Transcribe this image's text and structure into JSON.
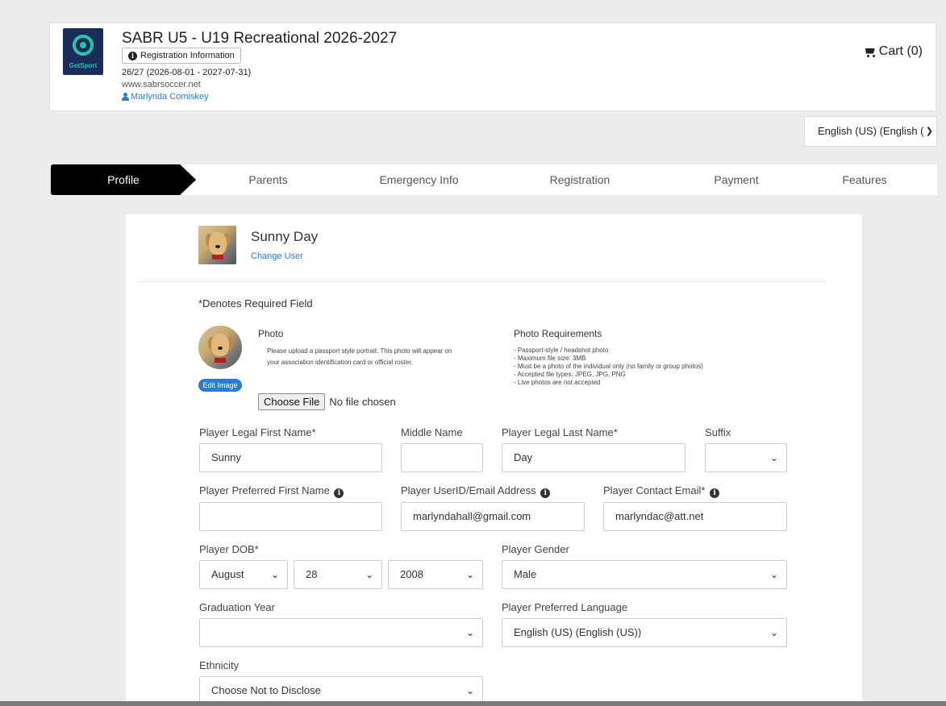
{
  "header": {
    "logo_text": "GotSport",
    "title": "SABR U5 - U19 Recreational 2026-2027",
    "registration_info_label": "Registration Information",
    "season": "26/27 (2026-08-01 - 2027-07-31)",
    "website": "www.sabrsoccer.net",
    "user": "Marlynda Comiskey",
    "cart_label": "Cart (0)"
  },
  "language_select": {
    "value": "English (US) (English ("
  },
  "steps": [
    {
      "label": "Profile",
      "active": true
    },
    {
      "label": "Parents"
    },
    {
      "label": "Emergency Info"
    },
    {
      "label": "Registration"
    },
    {
      "label": "Payment"
    },
    {
      "label": "Features"
    }
  ],
  "profile": {
    "name": "Sunny Day",
    "change_user_label": "Change User",
    "required_note": "*Denotes Required Field",
    "photo_label": "Photo",
    "photo_help": "Please upload a passport style portrait. This photo will appear on your association identification card or official roster.",
    "edit_image_label": "Edit Image",
    "choose_file_label": "Choose File",
    "no_file_text": "No file chosen",
    "requirements_title": "Photo Requirements",
    "requirements": [
      "- Passport-style / headshot photo",
      "- Maximum file size: 3MB",
      "- Must be a photo of the individual only (no family or group photos)",
      "- Accepted file types: JPEG, JPG, PNG",
      "- Live photos are not accepted"
    ]
  },
  "form": {
    "first_name": {
      "label": "Player Legal First Name*",
      "value": "Sunny"
    },
    "middle_name": {
      "label": "Middle Name",
      "value": ""
    },
    "last_name": {
      "label": "Player Legal Last Name*",
      "value": "Day"
    },
    "suffix": {
      "label": "Suffix",
      "value": ""
    },
    "preferred_first_name": {
      "label": "Player Preferred First Name",
      "value": ""
    },
    "user_email": {
      "label": "Player UserID/Email Address",
      "value": "marlyndahall@gmail.com"
    },
    "contact_email": {
      "label": "Player Contact Email*",
      "value": "marlyndac@att.net"
    },
    "dob": {
      "label": "Player DOB*",
      "month": "August",
      "day": "28",
      "year": "2008"
    },
    "gender": {
      "label": "Player Gender",
      "value": "Male"
    },
    "graduation_year": {
      "label": "Graduation Year",
      "value": ""
    },
    "preferred_language": {
      "label": "Player Preferred Language",
      "value": "English (US) (English (US))"
    },
    "ethnicity": {
      "label": "Ethnicity",
      "value": "Choose Not to Disclose"
    }
  }
}
